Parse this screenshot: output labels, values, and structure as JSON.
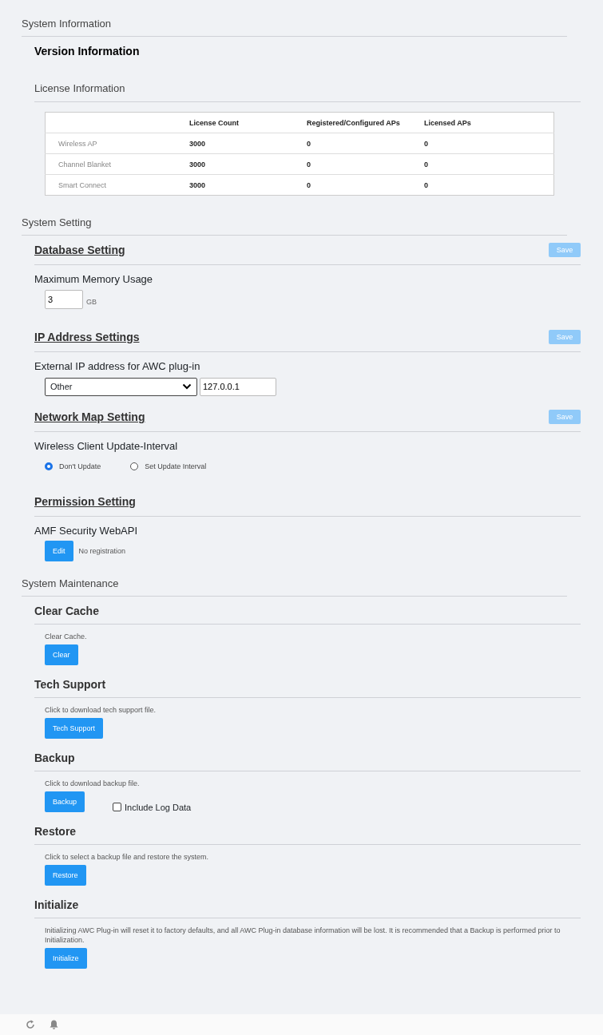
{
  "system_information": {
    "title": "System Information",
    "version_information": {
      "title": "Version Information"
    },
    "license_information": {
      "title": "License Information",
      "table": {
        "columns": [
          "License Count",
          "Registered/Configured APs",
          "Licensed APs"
        ],
        "rows": [
          {
            "name": "Wireless AP",
            "cells": [
              "3000",
              "0",
              "0"
            ]
          },
          {
            "name": "Channel Blanket",
            "cells": [
              "3000",
              "0",
              "0"
            ]
          },
          {
            "name": "Smart Connect",
            "cells": [
              "3000",
              "0",
              "0"
            ]
          }
        ]
      }
    }
  },
  "system_setting": {
    "title": "System Setting",
    "sections": [
      {
        "kind": "memory",
        "title": "Database Setting",
        "save_button": {
          "label": "Save",
          "disabled": true
        },
        "label": "Maximum Memory Usage",
        "value": "3",
        "unit": "GB"
      },
      {
        "kind": "ip",
        "title": "IP Address Settings",
        "save_button": {
          "label": "Save",
          "disabled": true
        },
        "label": "External IP address for AWC plug-in",
        "select_value": "Other",
        "ip_value": "127.0.0.1"
      },
      {
        "kind": "radio",
        "title": "Network Map Setting",
        "save_button": {
          "label": "Save",
          "disabled": true
        },
        "label": "Wireless Client Update-Interval",
        "options": [
          {
            "label": "Don't Update",
            "selected": true
          },
          {
            "label": "Set Update Interval",
            "selected": false
          }
        ]
      },
      {
        "kind": "permission",
        "title": "Permission Setting",
        "label": "AMF Security WebAPI",
        "button": "Edit",
        "note": "No registration"
      }
    ]
  },
  "system_maintenance": {
    "title": "System Maintenance",
    "sections": [
      {
        "title": "Clear Cache",
        "description": "Clear Cache.",
        "button": "Clear"
      },
      {
        "title": "Tech Support",
        "description": "Click to download tech support file.",
        "button": "Tech Support"
      },
      {
        "title": "Backup",
        "description": "Click to download backup file.",
        "button": "Backup",
        "checkbox": {
          "label": "Include Log Data",
          "checked": false
        }
      },
      {
        "title": "Restore",
        "description": "Click to select a backup file and restore the system.",
        "button": "Restore"
      },
      {
        "title": "Initialize",
        "description": "Initializing AWC Plug-in will reset it to factory defaults, and all AWC Plug-in database information will be lost. It is recommended that a Backup is performed prior to Initialization.",
        "button": "Initialize"
      }
    ]
  }
}
